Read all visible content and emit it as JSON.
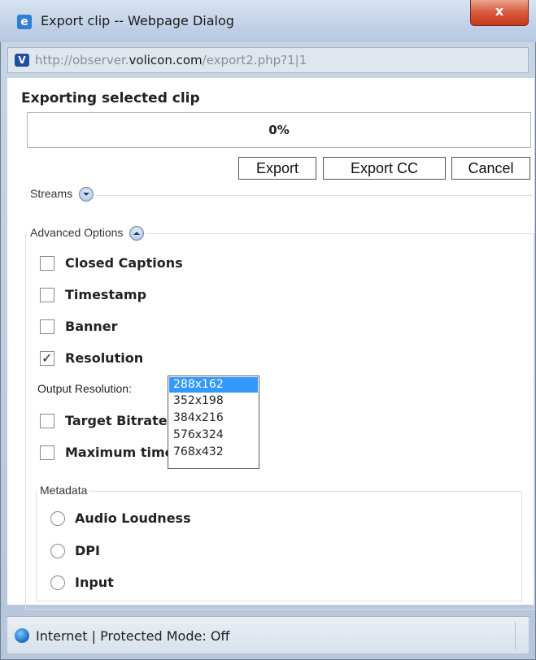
{
  "window": {
    "title": "Export clip -- Webpage Dialog",
    "close_label": "x",
    "url_prefix": "http://observer.",
    "url_domain": "volicon.com",
    "url_suffix": "/export2.php?1|1"
  },
  "dialog": {
    "heading": "Exporting selected clip",
    "progress_text": "0%",
    "progress_value": 0,
    "buttons": {
      "export": "Export",
      "export_cc": "Export CC",
      "cancel": "Cancel"
    },
    "streams_label": "Streams",
    "advanced_label": "Advanced Options",
    "options": [
      {
        "label": "Closed Captions",
        "checked": false
      },
      {
        "label": "Timestamp",
        "checked": false
      },
      {
        "label": "Banner",
        "checked": false
      },
      {
        "label": "Resolution",
        "checked": true
      },
      {
        "label": "Target Bitrate",
        "checked": false
      },
      {
        "label": "Maximum time",
        "checked": false
      }
    ],
    "output_resolution_label": "Output Resolution:",
    "resolutions": [
      "288x162",
      "352x198",
      "384x216",
      "576x324",
      "768x432"
    ],
    "selected_resolution": "288x162",
    "metadata_label": "Metadata",
    "metadata_options": [
      "Audio Loudness",
      "DPI",
      "Input"
    ]
  },
  "status": {
    "text": "Internet | Protected Mode: Off"
  }
}
